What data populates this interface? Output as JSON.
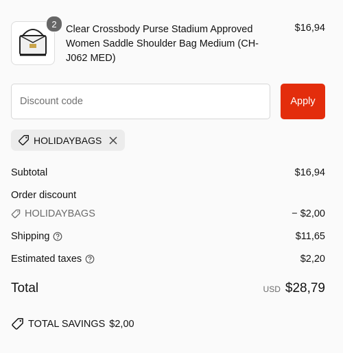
{
  "product": {
    "quantity": "2",
    "title": "Clear Crossbody Purse Stadium Approved Women Saddle Shoulder Bag Medium (CH-J062 MED)",
    "price": "$16,94"
  },
  "discount": {
    "placeholder": "Discount code",
    "apply_label": "Apply",
    "applied_code": "HOLIDAYBAGS"
  },
  "summary": {
    "subtotal_label": "Subtotal",
    "subtotal_value": "$16,94",
    "order_discount_label": "Order discount",
    "discount_code": "HOLIDAYBAGS",
    "discount_value": "− $2,00",
    "shipping_label": "Shipping",
    "shipping_value": "$11,65",
    "taxes_label": "Estimated taxes",
    "taxes_value": "$2,20"
  },
  "total": {
    "label": "Total",
    "currency": "USD",
    "amount": "$28,79"
  },
  "savings": {
    "label": "TOTAL SAVINGS",
    "amount": "$2,00"
  },
  "colors": {
    "accent": "#e32d0c",
    "badge": "#666666",
    "tag_bg": "#ececec"
  }
}
